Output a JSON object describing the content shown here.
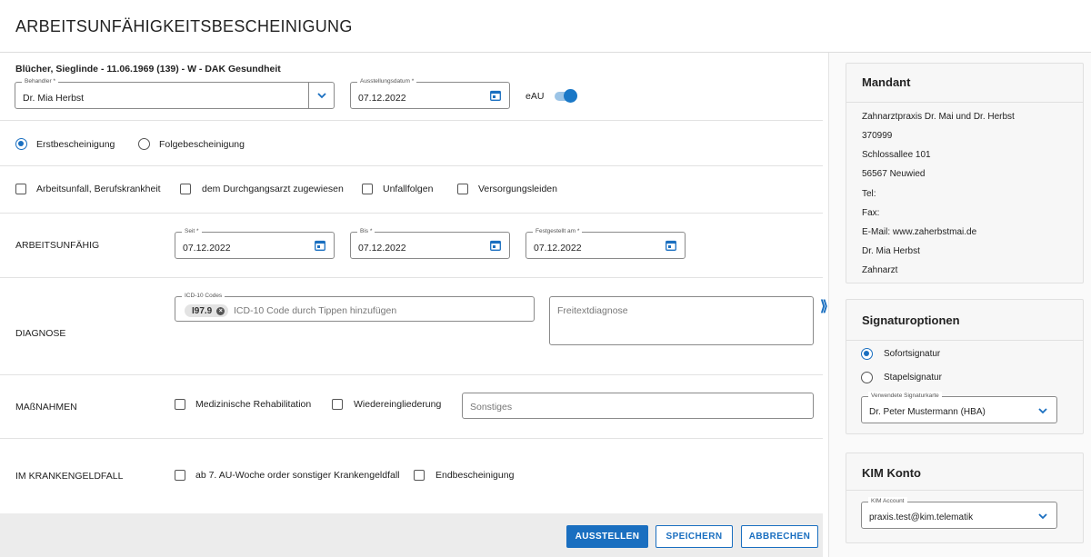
{
  "page": {
    "title": "ARBEITSUNFÄHIGKEITSBESCHEINIGUNG"
  },
  "patient": {
    "line": "Blücher, Sieglinde - 11.06.1969 (139) - W - DAK Gesundheit"
  },
  "header_fields": {
    "behandler_label": "Behandler *",
    "behandler_value": "Dr. Mia Herbst",
    "ausstellungsdatum_label": "Ausstellungsdatum *",
    "ausstellungsdatum_value": "07.12.2022",
    "eau_label": "eAU",
    "eau_enabled": true
  },
  "certificate_type": {
    "options": [
      {
        "label": "Erstbescheinigung",
        "selected": true
      },
      {
        "label": "Folgebescheinigung",
        "selected": false
      }
    ]
  },
  "flags": [
    {
      "label": "Arbeitsunfall, Berufskrankheit",
      "checked": false
    },
    {
      "label": "dem Durchgangsarzt zugewiesen",
      "checked": false
    },
    {
      "label": "Unfallfolgen",
      "checked": false
    },
    {
      "label": "Versorgungsleiden",
      "checked": false
    }
  ],
  "arbeitsunfaehig": {
    "section_label": "ARBEITSUNFÄHIG",
    "seit_label": "Seit *",
    "seit_value": "07.12.2022",
    "bis_label": "Bis *",
    "bis_value": "07.12.2022",
    "festgestellt_label": "Festgestellt am *",
    "festgestellt_value": "07.12.2022"
  },
  "diagnose": {
    "section_label": "DIAGNOSE",
    "icd_label": "ICD-10 Codes",
    "icd_chip": "I97.9",
    "icd_placeholder": "ICD-10 Code durch Tippen hinzufügen",
    "freitext_placeholder": "Freitextdiagnose"
  },
  "massnahmen": {
    "section_label": "MAßNAHMEN",
    "options": [
      {
        "label": "Medizinische Rehabilitation",
        "checked": false
      },
      {
        "label": "Wiedereingliederung",
        "checked": false
      }
    ],
    "sonstiges_placeholder": "Sonstiges"
  },
  "krankengeld": {
    "section_label": "IM KRANKENGELDFALL",
    "options": [
      {
        "label": "ab 7. AU-Woche order sonstiger Krankengeldfall",
        "checked": false
      },
      {
        "label": "Endbescheinigung",
        "checked": false
      }
    ]
  },
  "footer": {
    "ausstellen": "AUSSTELLEN",
    "speichern": "SPEICHERN",
    "abbrechen": "ABBRECHEN"
  },
  "expander_icon": "double-chevron-right-icon",
  "mandant": {
    "title": "Mandant",
    "lines": [
      "Zahnarztpraxis Dr. Mai und Dr. Herbst",
      "370999",
      "Schlossallee 101",
      "56567 Neuwied",
      "Tel:",
      "Fax:",
      "E-Mail: www.zaherbstmai.de",
      "Dr. Mia Herbst",
      "Zahnarzt"
    ]
  },
  "signatur": {
    "title": "Signaturoptionen",
    "options": [
      {
        "label": "Sofortsignatur",
        "selected": true
      },
      {
        "label": "Stapelsignatur",
        "selected": false
      }
    ],
    "karte_label": "Verwendete Signaturkarte",
    "karte_value": "Dr. Peter Mustermann (HBA)"
  },
  "kim": {
    "title": "KIM Konto",
    "account_label": "KIM Account",
    "account_value": "praxis.test@kim.telematik"
  },
  "colors": {
    "accent": "#1a6fc0",
    "footer_bg": "#ececec",
    "sidebar_bg": "#f7f7f7"
  }
}
